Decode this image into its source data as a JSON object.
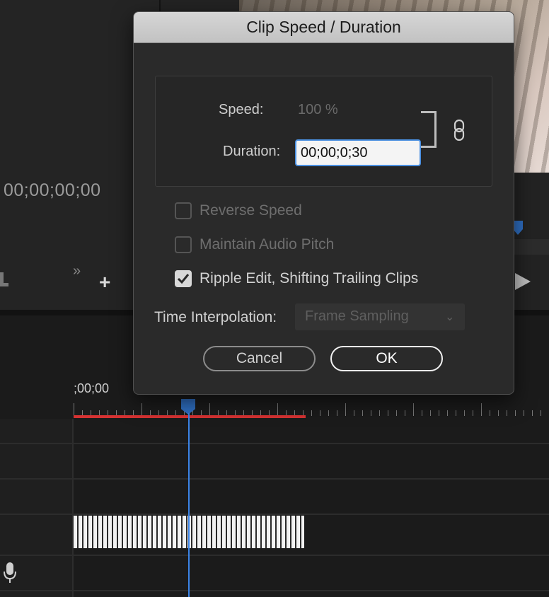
{
  "background": {
    "program_timecode": "00;00;00;00",
    "sequence_timecode": ";00;00"
  },
  "dialog": {
    "title": "Clip Speed / Duration",
    "speed": {
      "label": "Speed:",
      "value": "100 %"
    },
    "duration": {
      "label": "Duration:",
      "value": "00;00;0;30"
    },
    "checkboxes": [
      {
        "label": "Reverse Speed",
        "checked": false,
        "enabled": false
      },
      {
        "label": "Maintain Audio Pitch",
        "checked": false,
        "enabled": false
      },
      {
        "label": "Ripple Edit, Shifting Trailing Clips",
        "checked": true,
        "enabled": true
      }
    ],
    "time_interpolation": {
      "label": "Time Interpolation:",
      "value": "Frame Sampling"
    },
    "buttons": {
      "cancel": "Cancel",
      "ok": "OK"
    }
  },
  "icons": [
    "link-icon",
    "play-icon",
    "microphone-icon",
    "add-icon",
    "forward-icon",
    "chevron-down-icon",
    "checkmark-icon"
  ],
  "colors": {
    "accent": "#2f6fc3",
    "playhead_line": "#3b84e6",
    "work_area_bar": "#d63232"
  }
}
